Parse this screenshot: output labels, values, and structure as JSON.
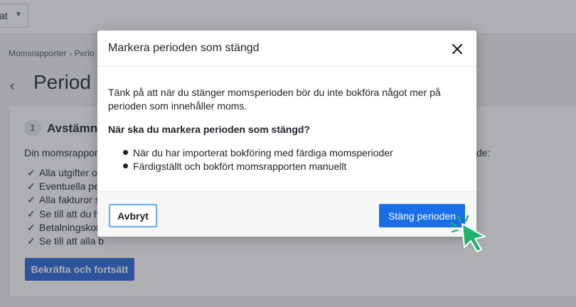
{
  "topbar": {
    "select_text": "at",
    "chevron_icon": "chevron-down-icon"
  },
  "breadcrumb": {
    "first": "Momsrapporter",
    "separator": "›",
    "second": "Perio"
  },
  "page": {
    "back_icon": "back-arrow-icon",
    "title": "Period o"
  },
  "card": {
    "step_number": "1",
    "step_title": "Avstämnin",
    "intro": "Din momsrapport",
    "intro_end": "de:",
    "checklist": [
      "Alla utgifter o",
      "Eventuella per",
      "Alla fakturor s",
      "Se till att du ha",
      "Betalningskon",
      "Se till att alla b"
    ],
    "checklist_tail_fragment": "",
    "confirm_button": "Bekräfta och fortsätt"
  },
  "modal": {
    "title": "Markera perioden som stängd",
    "close_icon": "close-icon",
    "body_text": "Tänk på att när du stänger momsperioden bör du inte bokföra något mer på perioden som innehåller moms.",
    "question": "När ska du markera perioden som stängd?",
    "options": [
      "När du har importerat bokföring med färdiga momsperioder",
      "Färdigställt och bokfört momsrapporten manuellt"
    ],
    "cancel_button": "Avbryt",
    "confirm_button": "Stäng perioden"
  },
  "colors": {
    "primary": "#1a6fe8",
    "cursor": "#1fb36b",
    "cancel_border": "#69aaf0"
  },
  "cursor_icon": "pointer-cursor-icon"
}
